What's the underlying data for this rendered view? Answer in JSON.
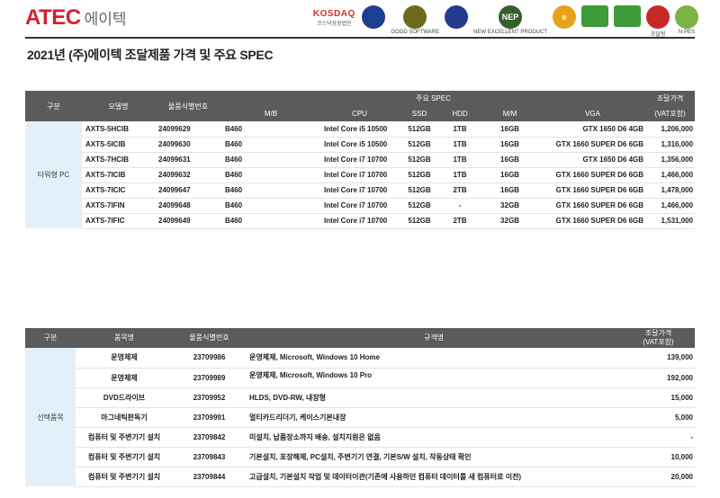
{
  "header": {
    "logo_brand": "ATEC",
    "logo_korean": "에이텍",
    "title": "2021년 (주)에이텍 조달제품 가격 및 주요 SPEC",
    "certs": [
      {
        "name": "kosdaq-logo",
        "text": "KOSDAQ",
        "sub": "코스닥상장법인",
        "color": "#d32f2f"
      },
      {
        "name": "gs-cert-logo",
        "text": "",
        "color": "#1d3f8f"
      },
      {
        "name": "good-software-logo",
        "text": "",
        "color": "#6b6b1c",
        "label": "GOOD SOFTWARE"
      },
      {
        "name": "kc-cert-logo",
        "text": "",
        "color": "#243a8c"
      },
      {
        "name": "nep-logo",
        "text": "NEP",
        "color": "#355e2b",
        "label": "NEW EXCELLENT PRODUCT"
      },
      {
        "name": "e-cert-logo",
        "text": "e",
        "color": "#e8a21a"
      },
      {
        "name": "eco-label-logo",
        "text": "",
        "color": "#3e9b3a"
      },
      {
        "name": "energy-label-logo",
        "text": "",
        "color": "#3e9b3a"
      },
      {
        "name": "taeguk-logo",
        "text": "",
        "color": "#c62828",
        "label": "조달청"
      },
      {
        "name": "nep-green-logo",
        "text": "",
        "color": "#7cb342",
        "label": "N·PES"
      }
    ]
  },
  "table1": {
    "headers_top": {
      "category": "구분",
      "model": "모델명",
      "id": "물품식별번호",
      "spec": "주요 SPEC",
      "price": "조달가격"
    },
    "headers_sub": {
      "mb": "M/B",
      "cpu": "CPU",
      "ssd": "SSD",
      "hdd": "HDD",
      "mm": "M/M",
      "vga": "VGA",
      "price_vat": "(VAT포함)"
    },
    "category": "타워형 PC",
    "rows": [
      {
        "model": "AXTS-5HCIB",
        "id": "24099629",
        "mb": "B460",
        "cpu": "Intel Core i5 10500",
        "ssd": "512GB",
        "hdd": "1TB",
        "mm": "16GB",
        "vga": "GTX 1650 D6 4GB",
        "price": "1,206,000"
      },
      {
        "model": "AXTS-5ICIB",
        "id": "24099630",
        "mb": "B460",
        "cpu": "Intel Core i5 10500",
        "ssd": "512GB",
        "hdd": "1TB",
        "mm": "16GB",
        "vga": "GTX 1660 SUPER D6 6GB",
        "price": "1,316,000"
      },
      {
        "model": "AXTS-7HCIB",
        "id": "24099631",
        "mb": "B460",
        "cpu": "Intel Core i7 10700",
        "ssd": "512GB",
        "hdd": "1TB",
        "mm": "16GB",
        "vga": "GTX 1650 D6 4GB",
        "price": "1,356,000"
      },
      {
        "model": "AXTS-7ICIB",
        "id": "24099632",
        "mb": "B460",
        "cpu": "Intel Core i7 10700",
        "ssd": "512GB",
        "hdd": "1TB",
        "mm": "16GB",
        "vga": "GTX 1660 SUPER D6 6GB",
        "price": "1,466,000"
      },
      {
        "model": "AXTS-7ICIC",
        "id": "24099647",
        "mb": "B460",
        "cpu": "Intel Core i7 10700",
        "ssd": "512GB",
        "hdd": "2TB",
        "mm": "16GB",
        "vga": "GTX 1660 SUPER D6 6GB",
        "price": "1,478,000"
      },
      {
        "model": "AXTS-7IFIN",
        "id": "24099648",
        "mb": "B460",
        "cpu": "Intel Core i7 10700",
        "ssd": "512GB",
        "hdd": "-",
        "mm": "32GB",
        "vga": "GTX 1660 SUPER D6 6GB",
        "price": "1,466,000"
      },
      {
        "model": "AXTS-7IFIC",
        "id": "24099649",
        "mb": "B460",
        "cpu": "Intel Core i7 10700",
        "ssd": "512GB",
        "hdd": "2TB",
        "mm": "32GB",
        "vga": "GTX 1660 SUPER D6 6GB",
        "price": "1,531,000"
      }
    ]
  },
  "table2": {
    "headers": {
      "category": "구분",
      "item": "품목명",
      "id": "물품식별번호",
      "spec": "규격명",
      "price_line1": "조달가격",
      "price_line2": "(VAT포함)"
    },
    "category": "선택품목",
    "rows": [
      {
        "item": "운영체제",
        "id": "23709986",
        "spec": "운영체제, Microsoft, Windows 10 Home",
        "price": "139,000"
      },
      {
        "item": "운영체제",
        "id": "23709989",
        "spec": "운영체제, Microsoft, Windows 10 Pro",
        "price": "192,000"
      },
      {
        "item": "DVD드라이브",
        "id": "23709952",
        "spec": "HLDS, DVD-RW, 내장형",
        "price": "15,000"
      },
      {
        "item": "마그네틱판독기",
        "id": "23709991",
        "spec": "멀티카드리더기, 케이스기본내장",
        "price": "5,000"
      },
      {
        "item": "컴퓨터 및 주변기기 설치",
        "id": "23709842",
        "spec": "미설치, 납품장소까지 배송, 설치지원은 없음",
        "price": "-"
      },
      {
        "item": "컴퓨터 및 주변기기 설치",
        "id": "23709843",
        "spec": "기본설치, 포장해체, PC설치, 주변기기 연결, 기본S/W 설치, 작동상태 확인",
        "price": "10,000"
      },
      {
        "item": "컴퓨터 및 주변기기 설치",
        "id": "23709844",
        "spec": "고급설치, 기본설치 작업 및 데이터이관(기존에 사용하던 컴퓨터 데이터를 새 컴퓨터로 이전)",
        "price": "20,000"
      }
    ]
  }
}
